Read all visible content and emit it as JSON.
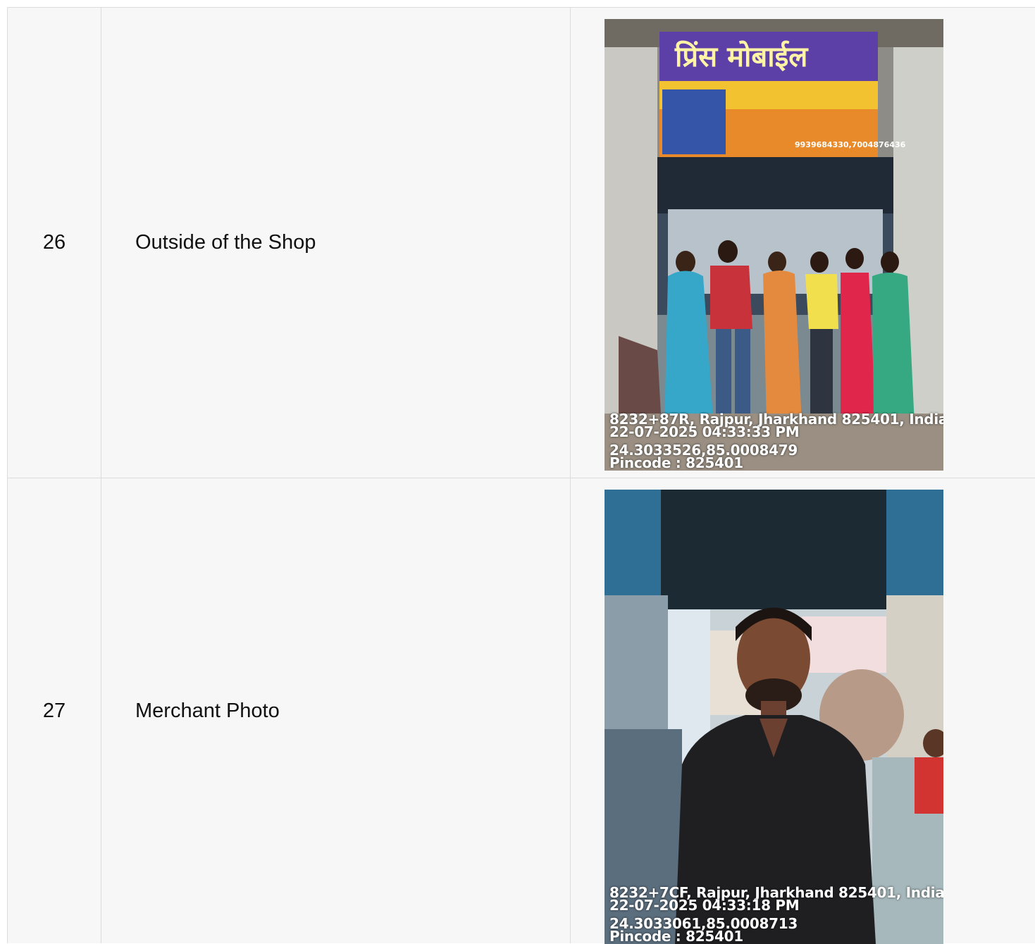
{
  "rows": [
    {
      "number": "26",
      "label": "Outside of the Shop",
      "photo": {
        "subject": "shop-front",
        "overlay": {
          "address": "8232+87R, Rajpur, Jharkhand 825401, India .",
          "datetime": "22-07-2025 04:33:33 PM",
          "coords": "24.3033526,85.0008479",
          "pincode": "Pincode : 825401"
        },
        "signboard": {
          "title": "प्रिंस मोबाईल",
          "phone": "9939684330,7004876436"
        }
      }
    },
    {
      "number": "27",
      "label": "Merchant Photo",
      "photo": {
        "subject": "merchant-portrait",
        "overlay": {
          "address": "8232+7CF, Rajpur, Jharkhand 825401, India .",
          "datetime": "22-07-2025 04:33:18 PM",
          "coords": "24.3033061,85.0008713",
          "pincode": "Pincode : 825401"
        }
      }
    }
  ]
}
